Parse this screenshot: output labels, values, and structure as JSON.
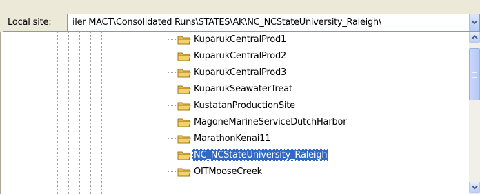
{
  "site_bar": {
    "label": "Local site:",
    "path_value": "iler MACT\\Consolidated Runs\\STATES\\AK\\NC_NCStateUniversity_Raleigh\\"
  },
  "tree": {
    "items": [
      {
        "label": "KuparukCentralProd1",
        "selected": false
      },
      {
        "label": "KuparukCentralProd2",
        "selected": false
      },
      {
        "label": "KuparukCentralProd3",
        "selected": false
      },
      {
        "label": "KuparukSeawaterTreat",
        "selected": false
      },
      {
        "label": "KustatanProductionSite",
        "selected": false
      },
      {
        "label": "MagoneMarineServiceDutchHarbor",
        "selected": false
      },
      {
        "label": "MarathonKenai11",
        "selected": false
      },
      {
        "label": "NC_NCStateUniversity_Raleigh",
        "selected": true
      },
      {
        "label": "OITMooseCreek",
        "selected": false
      }
    ],
    "item_icon": "folder-icon"
  },
  "colors": {
    "selection": "#316ac5",
    "folder": "#f4d26a",
    "window_bg": "#ece9d8"
  }
}
